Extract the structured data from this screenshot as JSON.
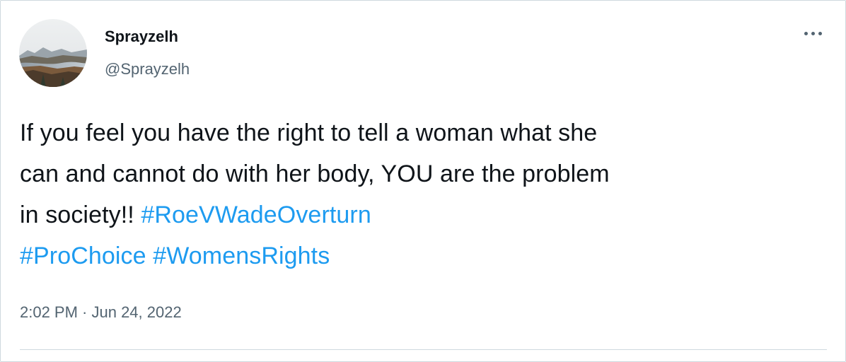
{
  "user": {
    "display_name": "Sprayzelh",
    "handle": "@Sprayzelh",
    "avatar_icon": "landscape-avatar"
  },
  "menu": {
    "icon": "more-options-icon"
  },
  "tweet": {
    "line1": "If you feel you have the right to tell a woman what she",
    "line2": "can and cannot do with her body, YOU are the problem",
    "line3_text": "in society!! ",
    "hashtags": [
      "#RoeVWadeOverturn",
      "#ProChoice",
      "#WomensRights"
    ],
    "timestamp": "2:02 PM · Jun 24, 2022"
  },
  "colors": {
    "hashtag": "#1d9bf0",
    "text": "#0f1419",
    "secondary": "#536471",
    "border": "#cfd9de"
  }
}
